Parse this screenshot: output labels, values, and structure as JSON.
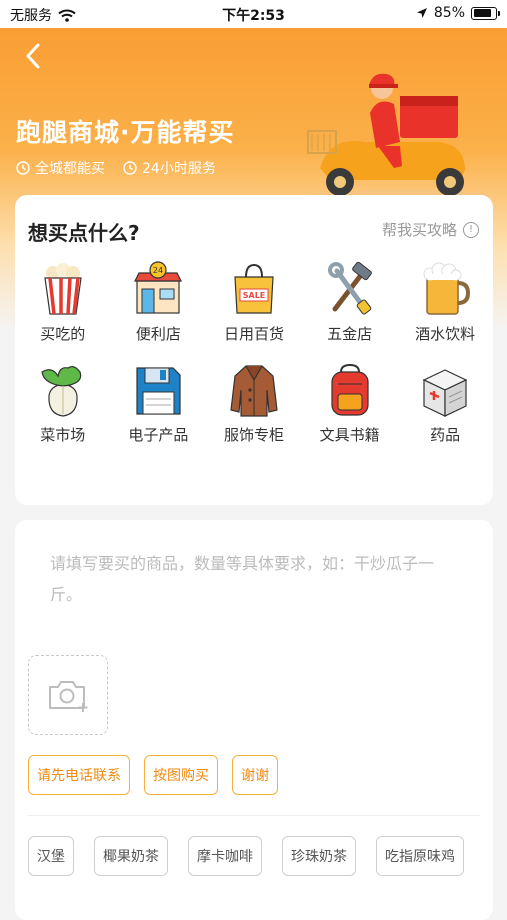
{
  "status_bar": {
    "carrier": "无服务",
    "time": "下午2:53",
    "battery": "85%"
  },
  "header": {
    "title": "跑腿商城·万能帮买",
    "features": [
      "全城都能买",
      "24小时服务"
    ]
  },
  "categories": {
    "title": "想买点什么?",
    "guide": "帮我买攻略",
    "items": [
      {
        "label": "买吃的",
        "icon": "popcorn-icon"
      },
      {
        "label": "便利店",
        "icon": "convenience-store-icon"
      },
      {
        "label": "日用百货",
        "icon": "shopping-bag-icon"
      },
      {
        "label": "五金店",
        "icon": "hammer-wrench-icon"
      },
      {
        "label": "酒水饮料",
        "icon": "beer-mug-icon"
      },
      {
        "label": "菜市场",
        "icon": "cabbage-icon"
      },
      {
        "label": "电子产品",
        "icon": "floppy-disk-icon"
      },
      {
        "label": "服饰专柜",
        "icon": "coat-icon"
      },
      {
        "label": "文具书籍",
        "icon": "backpack-icon"
      },
      {
        "label": "药品",
        "icon": "medicine-box-icon"
      }
    ]
  },
  "order_input": {
    "placeholder": "请填写要买的商品，数量等具体要求，如：干炒瓜子一斤。",
    "quick_notes": [
      "请先电话联系",
      "按图购买",
      "谢谢"
    ],
    "suggested_items": [
      "汉堡",
      "椰果奶茶",
      "摩卡咖啡",
      "珍珠奶茶",
      "吃指原味鸡"
    ]
  },
  "colors": {
    "accent": "#f99a2e",
    "chip_text": "#f08a12"
  }
}
